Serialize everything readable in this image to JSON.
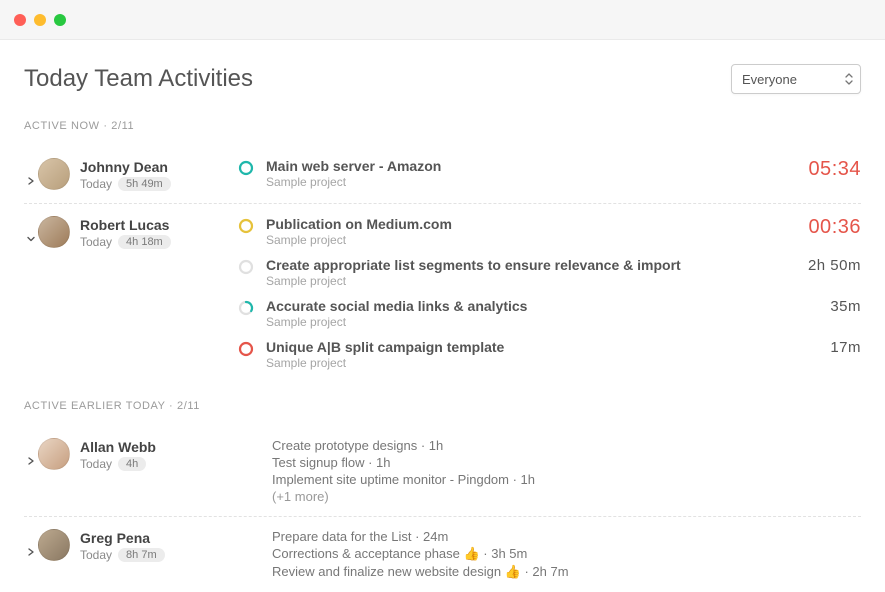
{
  "page": {
    "title": "Today Team Activities",
    "filter_selected": "Everyone"
  },
  "sections": {
    "active_now": {
      "header": "ACTIVE NOW · 2/11"
    },
    "active_earlier": {
      "header": "ACTIVE EARLIER TODAY · 2/11"
    }
  },
  "members": {
    "johnny": {
      "name": "Johnny Dean",
      "day": "Today",
      "duration": "5h 49m",
      "tasks": [
        {
          "title": "Main web server - Amazon",
          "project": "Sample project",
          "time": "05:34",
          "ring": "teal",
          "running": true
        }
      ]
    },
    "robert": {
      "name": "Robert Lucas",
      "day": "Today",
      "duration": "4h 18m",
      "tasks": [
        {
          "title": "Publication on Medium.com",
          "project": "Sample project",
          "time": "00:36",
          "ring": "yellow",
          "running": true
        },
        {
          "title": "Create appropriate list segments to ensure relevance & import",
          "project": "Sample project",
          "time": "2h 50m",
          "ring": "grey",
          "running": false
        },
        {
          "title": "Accurate social media links & analytics",
          "project": "Sample project",
          "time": "35m",
          "ring": "teal-partial",
          "running": false
        },
        {
          "title": "Unique A|B split campaign template",
          "project": "Sample project",
          "time": "17m",
          "ring": "red-ring",
          "running": false
        }
      ]
    },
    "allan": {
      "name": "Allan Webb",
      "day": "Today",
      "duration": "4h",
      "lines": [
        "Create prototype designs · 1h",
        "Test signup flow · 1h",
        "Implement site uptime monitor - Pingdom · 1h"
      ],
      "more": "(+1 more)"
    },
    "greg": {
      "name": "Greg Pena",
      "day": "Today",
      "duration": "8h 7m",
      "lines": [
        "Prepare data for the List · 24m",
        "Corrections & acceptance phase 👍 · 3h 5m",
        "Review and finalize new website design 👍 · 2h 7m"
      ]
    }
  },
  "ring_colors": {
    "teal": "#1fb7ab",
    "yellow": "#e6c23b",
    "grey": "#d7d7d7",
    "red": "#e5554a"
  }
}
